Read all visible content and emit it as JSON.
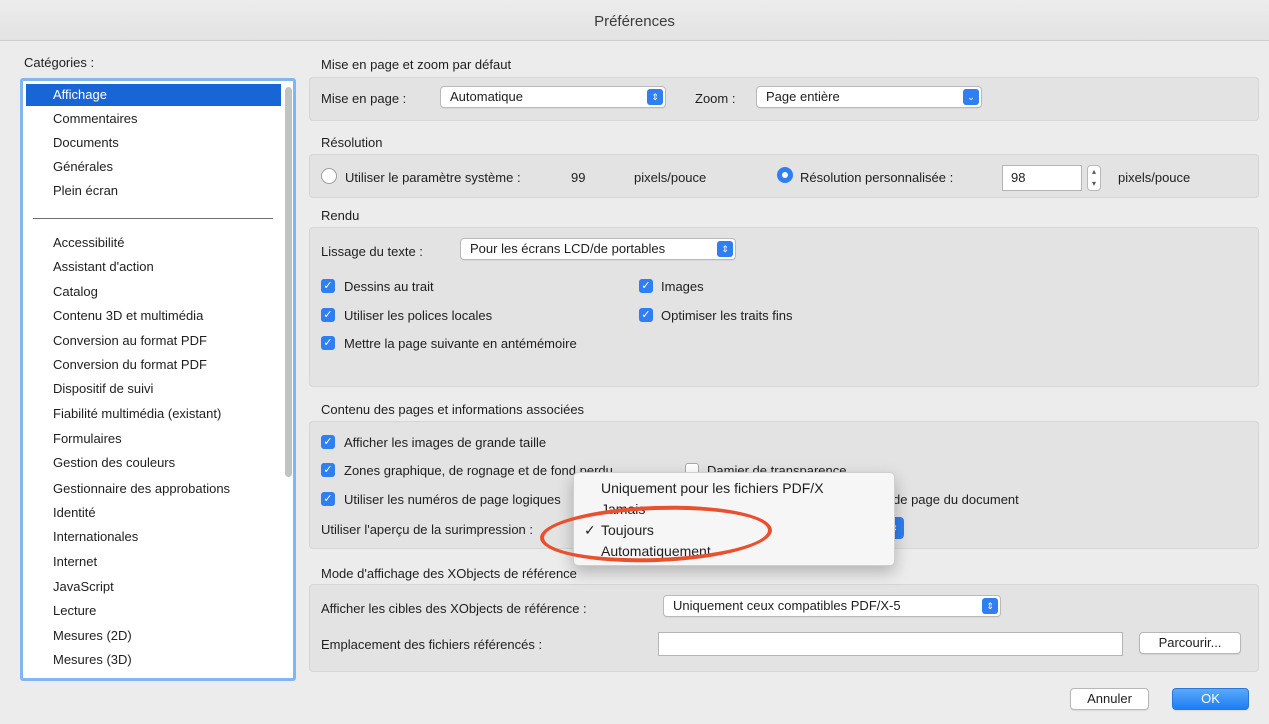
{
  "window": {
    "title": "Préférences"
  },
  "sidebar": {
    "label": "Catégories :",
    "top_items": [
      {
        "label": "Affichage",
        "selected": true
      },
      {
        "label": "Commentaires"
      },
      {
        "label": "Documents"
      },
      {
        "label": "Générales"
      },
      {
        "label": "Plein écran"
      }
    ],
    "items": [
      {
        "label": "Accessibilité"
      },
      {
        "label": "Assistant d'action"
      },
      {
        "label": "Catalog"
      },
      {
        "label": "Contenu 3D et multimédia"
      },
      {
        "label": "Conversion au format PDF"
      },
      {
        "label": "Conversion du format PDF"
      },
      {
        "label": "Dispositif de suivi"
      },
      {
        "label": "Fiabilité multimédia (existant)"
      },
      {
        "label": "Formulaires"
      },
      {
        "label": "Gestion des couleurs"
      },
      {
        "label": "Gestionnaire des approbations"
      },
      {
        "label": "Identité"
      },
      {
        "label": "Internationales"
      },
      {
        "label": "Internet"
      },
      {
        "label": "JavaScript"
      },
      {
        "label": "Lecture"
      },
      {
        "label": "Mesures (2D)"
      },
      {
        "label": "Mesures (3D)"
      }
    ]
  },
  "layout_zoom": {
    "section": "Mise en page et zoom par défaut",
    "layout_label": "Mise en page :",
    "layout_value": "Automatique",
    "zoom_label": "Zoom :",
    "zoom_value": "Page entière"
  },
  "resolution": {
    "section": "Résolution",
    "system_label": "Utiliser le paramètre système :",
    "system_value": "99",
    "system_unit": "pixels/pouce",
    "custom_label": "Résolution personnalisée :",
    "custom_value": "98",
    "custom_unit": "pixels/pouce"
  },
  "rendu": {
    "section": "Rendu",
    "smoothing_label": "Lissage du texte :",
    "smoothing_value": "Pour les écrans LCD/de portables",
    "cb_line_art": "Dessins au trait",
    "cb_images": "Images",
    "cb_local_fonts": "Utiliser les polices locales",
    "cb_thin_lines": "Optimiser les traits fins",
    "cb_cache": "Mettre la page suivante en antémémoire"
  },
  "content": {
    "section": "Contenu des pages et informations associées",
    "cb_large_images": "Afficher les images de grande taille",
    "cb_zones": "Zones graphique, de rognage et de fond perdu",
    "cb_transparency": "Damier de transparence",
    "cb_page_numbers": "Utiliser les numéros de page logiques",
    "page_numbers_tail": "de page du document",
    "overprint_label": "Utiliser l'aperçu de la surimpression :"
  },
  "overprint_menu": {
    "options": [
      "Uniquement pour les fichiers PDF/X",
      "Jamais",
      "Toujours",
      "Automatiquement"
    ],
    "checked": "Toujours",
    "check_glyph": "✓"
  },
  "xobjects": {
    "section": "Mode d'affichage des XObjects de référence",
    "targets_label": "Afficher les cibles des XObjects de référence :",
    "targets_value": "Uniquement ceux compatibles PDF/X-5",
    "location_label": "Emplacement des fichiers référencés :",
    "location_value": "",
    "browse_button": "Parcourir..."
  },
  "footer": {
    "cancel": "Annuler",
    "ok": "OK"
  },
  "colors": {
    "accent": "#2f7ef2",
    "selection": "#1866d5",
    "highlight_oval": "#e8502e"
  }
}
